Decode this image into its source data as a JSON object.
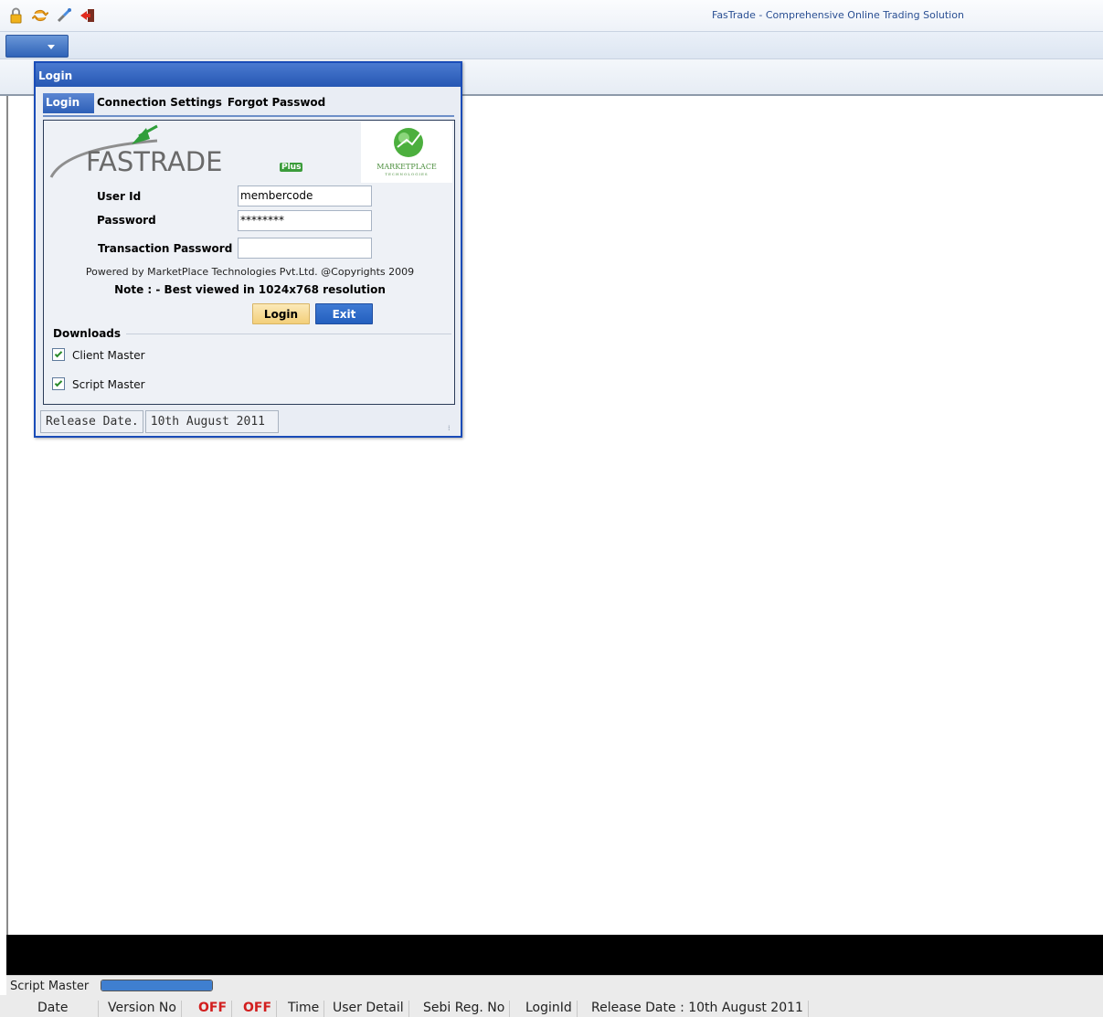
{
  "app": {
    "title": "FasTrade - Comprehensive Online Trading Solution",
    "toolbar_icons": [
      "lock-icon",
      "refresh-icon",
      "connect-icon",
      "exit-icon"
    ],
    "menu_dropdown_icon": "chevron-down-icon"
  },
  "dialog": {
    "title": "Login",
    "tabs": [
      {
        "label": "Login",
        "active": true
      },
      {
        "label": "Connection Settings",
        "active": false
      },
      {
        "label": "Forgot Passwod",
        "active": false
      }
    ],
    "logo": {
      "text": "FASTRADE",
      "badge": "Plus",
      "partner": "MARKETPLACE",
      "partner_sub": "TECHNOLOGIES"
    },
    "fields": {
      "user_id_label": "User Id",
      "user_id_value": "membercode",
      "password_label": "Password",
      "password_value": "********",
      "txn_password_label": "Transaction Password",
      "txn_password_value": ""
    },
    "powered_by": "Powered by MarketPlace Technologies Pvt.Ltd. @Copyrights 2009",
    "note": "Note : - Best viewed in 1024x768 resolution",
    "buttons": {
      "login": "Login",
      "exit": "Exit"
    },
    "downloads": {
      "legend": "Downloads",
      "items": [
        {
          "label": "Client Master",
          "checked": true
        },
        {
          "label": "Script Master",
          "checked": true
        }
      ]
    },
    "status": {
      "release_label": "Release Date.",
      "release_value": "10th August 2011"
    }
  },
  "script_master": {
    "label": "Script Master",
    "progress": 1.0
  },
  "statusbar": {
    "items": [
      "Date",
      "Version No",
      "OFF",
      "OFF",
      "Time",
      "User Detail",
      "Sebi Reg. No",
      "LoginId",
      "Release Date : 10th August 2011"
    ]
  },
  "colors": {
    "accent": "#2657b3",
    "off": "#d21e1e",
    "login_button": "#f3cf7a"
  }
}
